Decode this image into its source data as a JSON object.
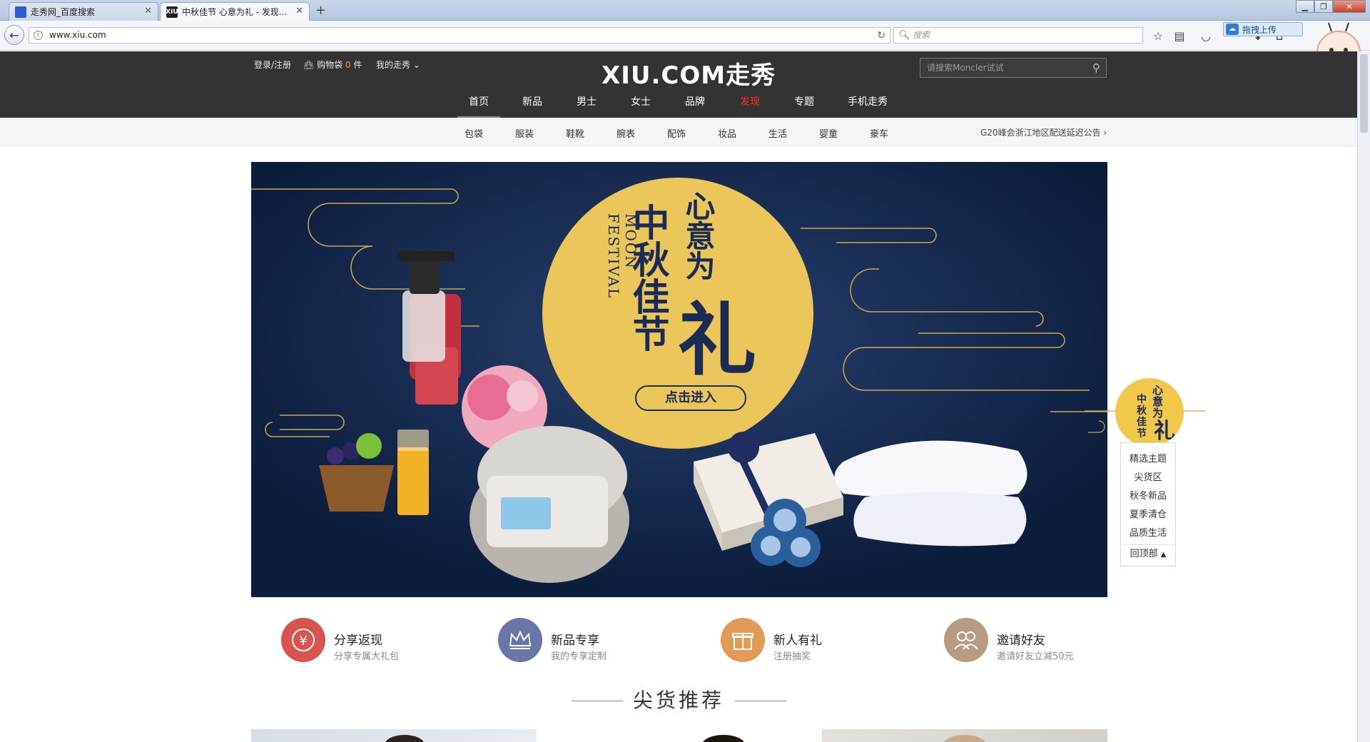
{
  "browser": {
    "tabs": [
      {
        "title": "走秀网_百度搜索",
        "favicon": "baidu-paw-icon",
        "active": false
      },
      {
        "title": "中秋佳节 心意为礼 - 发现...",
        "favicon": "xiu-icon",
        "active": true
      }
    ],
    "favicon_letters": "XIU",
    "url": "www.xiu.com",
    "search_placeholder": "搜索",
    "upload_label": "拖拽上传",
    "window_controls": [
      "minimize-icon",
      "maximize-icon",
      "close-icon"
    ]
  },
  "site": {
    "top_links": {
      "login": "登录/注册",
      "cart_label": "购物袋",
      "cart_count": "0",
      "cart_unit": "件",
      "my_account": "我的走秀"
    },
    "logo": "XIU.COM走秀",
    "search_placeholder": "请搜索Moncler试试",
    "main_nav": [
      "首页",
      "新品",
      "男士",
      "女士",
      "品牌",
      "发现",
      "专题",
      "手机走秀"
    ],
    "sub_nav": [
      "包袋",
      "服装",
      "鞋靴",
      "腕表",
      "配饰",
      "妆品",
      "生活",
      "婴童",
      "豪车"
    ],
    "notice": "G20峰会浙江地区配送延迟公告"
  },
  "banner": {
    "title_col1": "中秋佳节",
    "title_col2": "心意为",
    "title_big": "礼",
    "subtitle": "MOON FESTIVAL",
    "cta": "点击进入"
  },
  "features": [
    {
      "title": "分享返现",
      "subtitle": "分享专属大礼包",
      "icon": "yen-icon",
      "color": "#d9534f"
    },
    {
      "title": "新品专享",
      "subtitle": "我的专享定制",
      "icon": "crown-icon",
      "color": "#6a75a8"
    },
    {
      "title": "新人有礼",
      "subtitle": "注册抽奖",
      "icon": "gift-icon",
      "color": "#e39a55"
    },
    {
      "title": "邀请好友",
      "subtitle": "邀请好友立减50元",
      "icon": "friends-icon",
      "color": "#b79c82"
    }
  ],
  "section_title": "尖货推荐",
  "side_nav": {
    "badge_text": "心意为礼中秋佳节",
    "items": [
      "精选主题",
      "尖货区",
      "秋冬新品",
      "夏季清仓",
      "品质生活"
    ],
    "back_top": "回顶部"
  }
}
